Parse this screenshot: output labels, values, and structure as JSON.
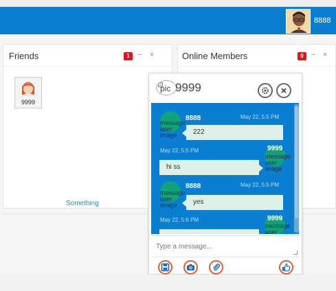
{
  "topbar": {
    "user_name": "8888",
    "accent": "#0a7fd1"
  },
  "friends_panel": {
    "title": "Friends",
    "badge": "1",
    "minimize": "−",
    "close": "×",
    "friends": [
      {
        "name": "9999"
      }
    ],
    "footer_link": "Something"
  },
  "online_panel": {
    "title": "Online Members",
    "badge": "0",
    "minimize": "−",
    "close": "×"
  },
  "chat": {
    "pic_alt": "pic",
    "title": "9999",
    "settings_icon": "gear-icon",
    "close_icon": "close-icon",
    "avatar_alt": "message user image",
    "messages": [
      {
        "side": "left",
        "name": "8888",
        "time": "May 22, 5:5 PM",
        "text": "222"
      },
      {
        "side": "right",
        "name": "9999",
        "time": "May 22, 5:5 PM",
        "text": "hi ss"
      },
      {
        "side": "left",
        "name": "8888",
        "time": "May 22, 5:5 PM",
        "text": "yes"
      },
      {
        "side": "right",
        "name": "9999",
        "time": "May 22, 5:6 PM",
        "text": "..."
      }
    ],
    "input_placeholder": "Type a message...",
    "tools": [
      "save-icon",
      "camera-icon",
      "attachment-icon",
      "thumbs-up-icon"
    ]
  }
}
